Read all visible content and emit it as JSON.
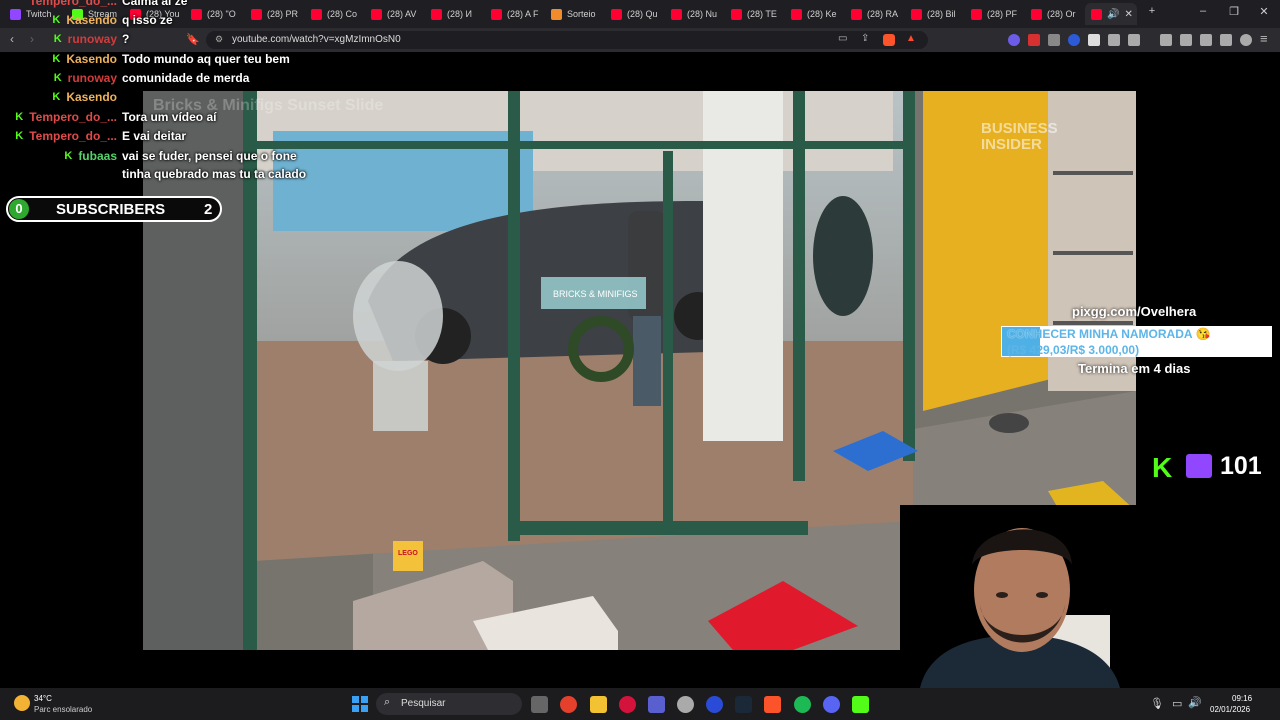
{
  "browser": {
    "tabs": [
      {
        "label": "Twitch",
        "color": "#9146ff"
      },
      {
        "label": "Stream",
        "color": "#53fc18"
      },
      {
        "label": "(28) You",
        "color": "#ff0033"
      },
      {
        "label": "(28) \"O",
        "color": "#ff0033"
      },
      {
        "label": "(28) PR",
        "color": "#ff0033"
      },
      {
        "label": "(28) Co",
        "color": "#ff0033"
      },
      {
        "label": "(28) AV",
        "color": "#ff0033"
      },
      {
        "label": "(28) И",
        "color": "#ff0033"
      },
      {
        "label": "(28) A F",
        "color": "#ff0033"
      },
      {
        "label": "Sorteio",
        "color": "#f08c2c"
      },
      {
        "label": "(28) Qu",
        "color": "#ff0033"
      },
      {
        "label": "(28) Nu",
        "color": "#ff0033"
      },
      {
        "label": "(28) TE",
        "color": "#ff0033"
      },
      {
        "label": "(28) Ke",
        "color": "#ff0033"
      },
      {
        "label": "(28) RA",
        "color": "#ff0033"
      },
      {
        "label": "(28) Bil",
        "color": "#ff0033"
      },
      {
        "label": "(28) PF",
        "color": "#ff0033"
      },
      {
        "label": "(28) Or",
        "color": "#ff0033"
      }
    ],
    "url": "youtube.com/watch?v=xgMzImnOsN0"
  },
  "chat": {
    "messages": [
      {
        "user": "Tempero_do_...",
        "text": "Calma ai ze",
        "color": "#e04a4a",
        "badge": false
      },
      {
        "user": "Kasendo",
        "text": "q isso ze",
        "color": "#f0b35a",
        "badge": true
      },
      {
        "user": "runoway",
        "text": "?",
        "color": "#d23c3c",
        "badge": true
      },
      {
        "user": "Kasendo",
        "text": "Todo mundo aq quer teu bem",
        "color": "#f0b35a",
        "badge": true
      },
      {
        "user": "runoway",
        "text": "comunidade de merda",
        "color": "#d23c3c",
        "badge": true
      },
      {
        "user": "Kasendo",
        "text": "",
        "color": "#f0b35a",
        "badge": true
      },
      {
        "user": "Tempero_do_...",
        "text": "Tora um vídeo aí",
        "color": "#e04a4a",
        "badge": true
      },
      {
        "user": "Tempero_do_...",
        "text": "E vai deitar",
        "color": "#e04a4a",
        "badge": true
      },
      {
        "user": "fubaas",
        "text": "vai se fuder, pensei que o fone",
        "color": "#55d36a",
        "badge": true
      },
      {
        "user": "",
        "text": "tinha quebrado mas tu ta calado",
        "color": "#ffffff",
        "badge": false
      }
    ]
  },
  "subscribers": {
    "label": "SUBSCRIBERS",
    "current": "0",
    "goal": "2"
  },
  "video": {
    "watermark": "BUSINESS INSIDER",
    "overlay_title": "Bricks & Minifigs Sunset Slide",
    "sign_text": "BRICKS & MINIFIGS",
    "lego_box": "LEGO"
  },
  "donation": {
    "site": "pixgg.com/Ovelhera",
    "goal_title": "CONHECER MINHA NAMORADA 😘",
    "goal_amount": "(R$ 429,03/R$ 3.000,00)",
    "goal_progress": 0.143,
    "ends": "Termina em 4 dias"
  },
  "viewers": {
    "count": "101"
  },
  "taskbar": {
    "weather_temp": "34°C",
    "weather_desc": "Parc ensolarado",
    "search": "Pesquisar",
    "time": "09:16",
    "date": "02/01/2026"
  }
}
